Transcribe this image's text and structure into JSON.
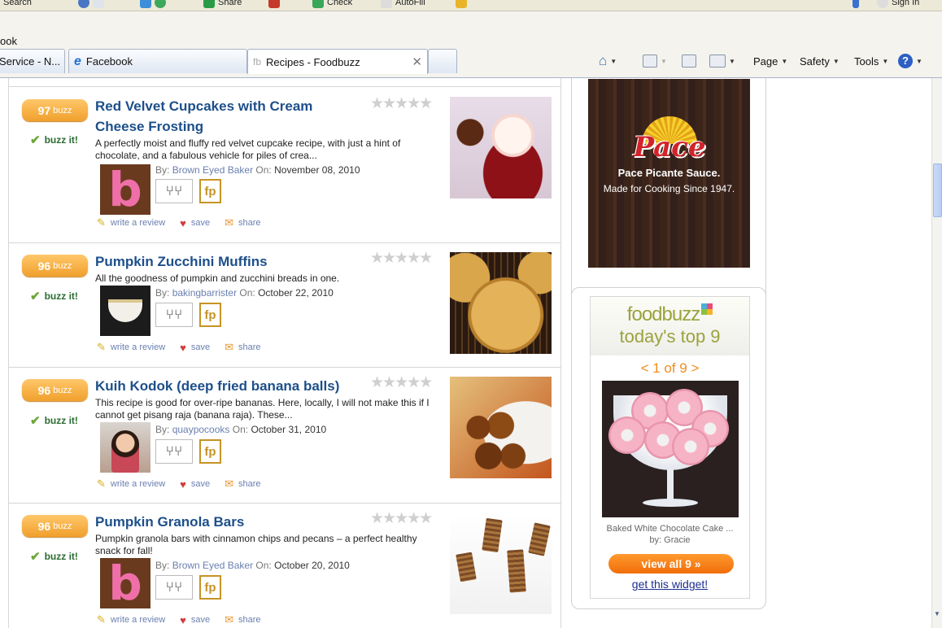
{
  "browser": {
    "top_toolbar": [
      "Search",
      "Share",
      "Check",
      "AutoFill",
      "Sign In"
    ],
    "links_bar_text": "ook",
    "tabs": [
      {
        "label": "Service - N..."
      },
      {
        "label": "Facebook"
      },
      {
        "label": "Recipes - Foodbuzz",
        "favicon": "fb"
      }
    ],
    "command_bar": {
      "page": "Page",
      "safety": "Safety",
      "tools": "Tools"
    },
    "icons": [
      "home-icon",
      "feeds-icon",
      "mail-icon",
      "print-icon",
      "help-icon"
    ]
  },
  "recipes": [
    {
      "buzz": "97",
      "buzz_unit": "buzz",
      "buzz_it": "buzz it!",
      "title": "Red Velvet Cupcakes with Cream Cheese Frosting",
      "description": "A perfectly moist and fluffy red velvet cupcake recipe, with just a hint of chocolate, and a fabulous vehicle for piles of crea...",
      "by_label": "By:",
      "author": "Brown Eyed Baker",
      "on_label": "On:",
      "date": "November 08, 2010",
      "badge": "fp"
    },
    {
      "buzz": "96",
      "buzz_unit": "buzz",
      "buzz_it": "buzz it!",
      "title": "Pumpkin Zucchini Muffins",
      "description": "All the goodness of pumpkin and zucchini breads in one.",
      "by_label": "By:",
      "author": "bakingbarrister",
      "on_label": "On:",
      "date": "October 22, 2010",
      "badge": "fp"
    },
    {
      "buzz": "96",
      "buzz_unit": "buzz",
      "buzz_it": "buzz it!",
      "title": "Kuih Kodok (deep fried banana balls)",
      "description": "This recipe is good for over-ripe bananas. Here, locally, I will not make this if I cannot get pisang raja (banana raja). These...",
      "by_label": "By:",
      "author": "quaypocooks",
      "on_label": "On:",
      "date": "October 31, 2010",
      "badge": "fp"
    },
    {
      "buzz": "96",
      "buzz_unit": "buzz",
      "buzz_it": "buzz it!",
      "title": "Pumpkin Granola Bars",
      "description": "Pumpkin granola bars with cinnamon chips and pecans – a perfect healthy snack for fall!",
      "by_label": "By:",
      "author": "Brown Eyed Baker",
      "on_label": "On:",
      "date": "October 20, 2010",
      "badge": "fp"
    }
  ],
  "actions": {
    "review": "write a review",
    "save": "save",
    "share": "share"
  },
  "ad": {
    "brand": "Pace",
    "line1": "Pace Picante Sauce.",
    "line2": "Made for Cooking Since 1947."
  },
  "widget": {
    "logo": "foodbuzz",
    "heading": "today's top 9",
    "nav": "< 1 of 9 >",
    "caption_title": "Baked White Chocolate Cake ...",
    "caption_by": "by: Gracie",
    "button": "view all 9 »",
    "link": "get this widget!"
  },
  "colors": {
    "buzz_orange": "#f0a02c",
    "title_blue": "#1d4f8a",
    "fp_gold": "#c69324",
    "foodbuzz_green": "#9aa33d"
  }
}
